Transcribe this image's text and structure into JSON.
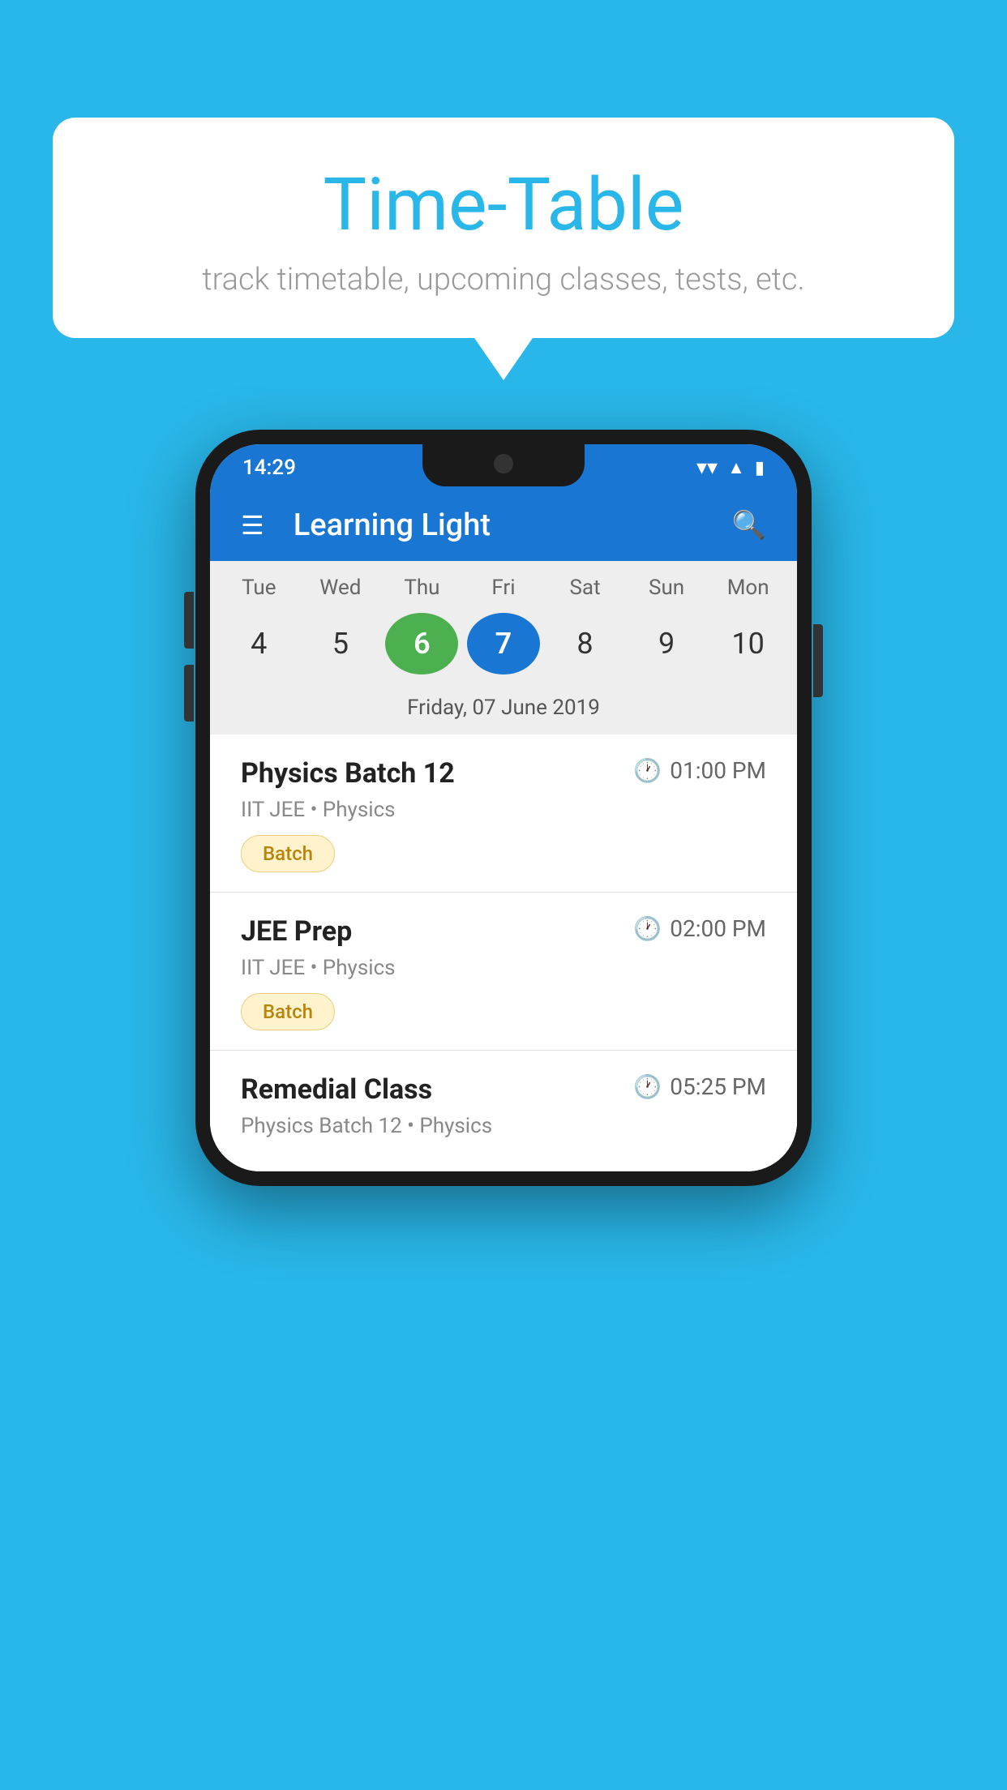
{
  "background_color": "#29b6e8",
  "speech_bubble": {
    "title": "Time-Table",
    "subtitle": "track timetable, upcoming classes, tests, etc."
  },
  "phone": {
    "status_bar": {
      "time": "14:29",
      "wifi_icon": "wifi",
      "signal_icon": "signal",
      "battery_icon": "battery"
    },
    "app_bar": {
      "title": "Learning Light",
      "menu_icon": "hamburger-menu",
      "search_icon": "search"
    },
    "calendar": {
      "days": [
        {
          "label": "Tue",
          "number": "4",
          "state": "normal"
        },
        {
          "label": "Wed",
          "number": "5",
          "state": "normal"
        },
        {
          "label": "Thu",
          "number": "6",
          "state": "today"
        },
        {
          "label": "Fri",
          "number": "7",
          "state": "selected"
        },
        {
          "label": "Sat",
          "number": "8",
          "state": "normal"
        },
        {
          "label": "Sun",
          "number": "9",
          "state": "normal"
        },
        {
          "label": "Mon",
          "number": "10",
          "state": "normal"
        }
      ],
      "selected_date_label": "Friday, 07 June 2019"
    },
    "schedule": [
      {
        "name": "Physics Batch 12",
        "time": "01:00 PM",
        "subtitle": "IIT JEE • Physics",
        "badge": "Batch"
      },
      {
        "name": "JEE Prep",
        "time": "02:00 PM",
        "subtitle": "IIT JEE • Physics",
        "badge": "Batch"
      },
      {
        "name": "Remedial Class",
        "time": "05:25 PM",
        "subtitle": "Physics Batch 12 • Physics",
        "badge": ""
      }
    ]
  }
}
